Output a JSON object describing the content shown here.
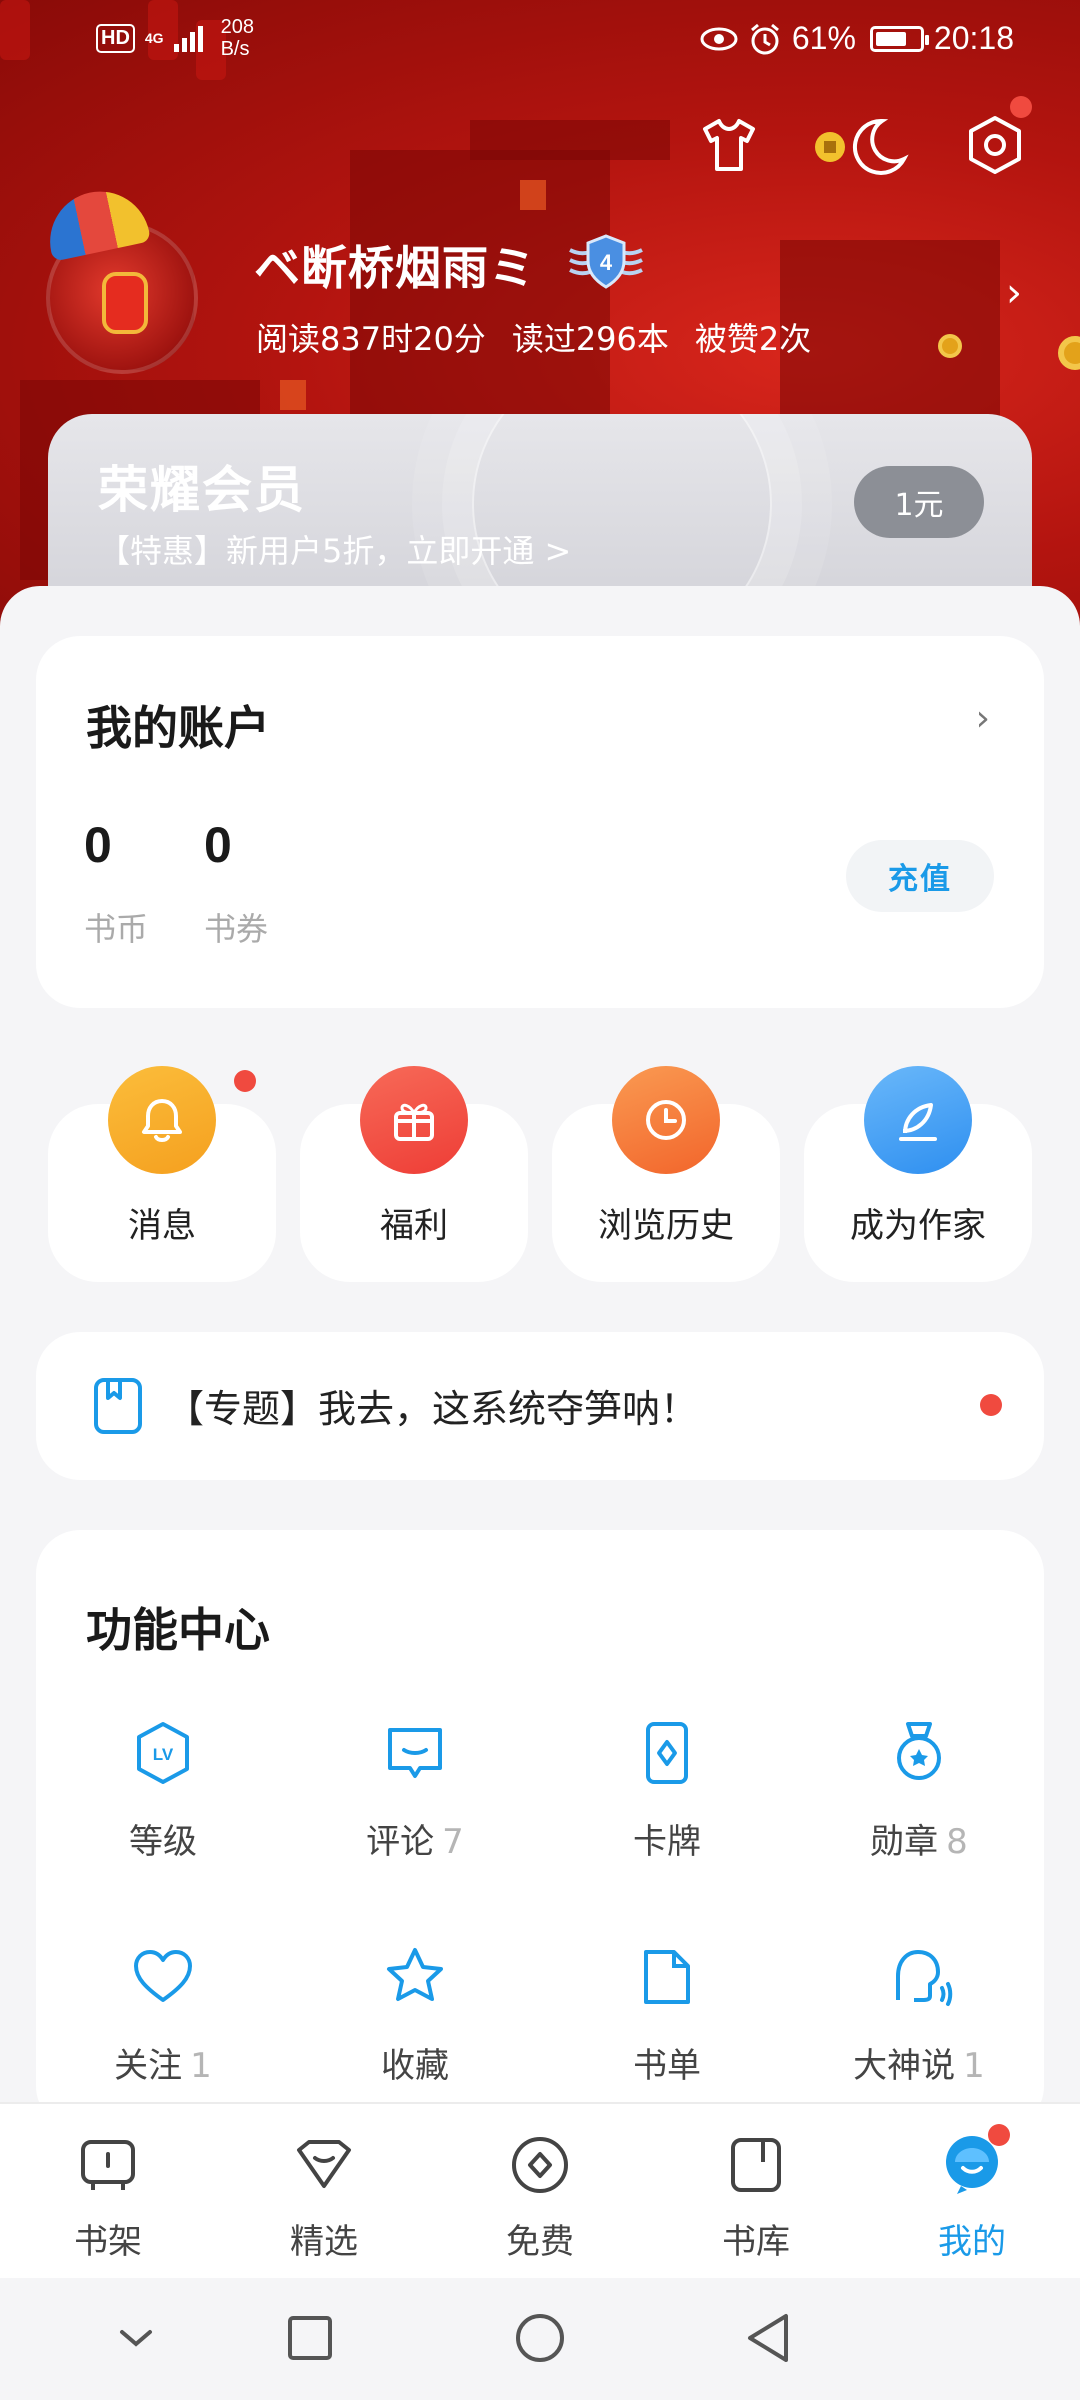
{
  "status_bar": {
    "network_badge": "HD",
    "signal_type": "4G",
    "speed": "208\nB/s",
    "battery": "61%",
    "time": "20:18"
  },
  "profile": {
    "username": "ベ断桥烟雨ミ",
    "level_badge": "4",
    "reading_time": "阅读837时20分",
    "books_read": "读过296本",
    "likes": "被赞2次"
  },
  "vip": {
    "title": "荣耀会员",
    "subtitle": "【特惠】新用户5折，立即开通 >",
    "button": "1元"
  },
  "account": {
    "title": "我的账户",
    "coins_value": "0",
    "coins_label": "书币",
    "vouchers_value": "0",
    "vouchers_label": "书券",
    "recharge": "充值"
  },
  "quick_actions": [
    {
      "label": "消息",
      "icon": "bell-icon",
      "color": "#f7a623"
    },
    {
      "label": "福利",
      "icon": "gift-icon",
      "color": "#f25545"
    },
    {
      "label": "浏览历史",
      "icon": "clock-icon",
      "color": "#f57b3c"
    },
    {
      "label": "成为作家",
      "icon": "quill-icon",
      "color": "#3d9df0"
    }
  ],
  "topic": {
    "text": "【专题】我去，这系统夺笋呐！"
  },
  "functions": {
    "title": "功能中心",
    "items": [
      {
        "label": "等级",
        "count": "",
        "icon": "level-icon"
      },
      {
        "label": "评论",
        "count": "7",
        "icon": "comment-icon"
      },
      {
        "label": "卡牌",
        "count": "",
        "icon": "card-icon"
      },
      {
        "label": "勋章",
        "count": "8",
        "icon": "medal-icon"
      },
      {
        "label": "关注",
        "count": "1",
        "icon": "heart-icon"
      },
      {
        "label": "收藏",
        "count": "",
        "icon": "star-icon"
      },
      {
        "label": "书单",
        "count": "",
        "icon": "booklist-icon"
      },
      {
        "label": "大神说",
        "count": "1",
        "icon": "speaker-icon"
      }
    ]
  },
  "bottom_nav": [
    {
      "label": "书架",
      "icon": "bookshelf-icon"
    },
    {
      "label": "精选",
      "icon": "featured-icon"
    },
    {
      "label": "免费",
      "icon": "free-icon"
    },
    {
      "label": "书库",
      "icon": "library-icon"
    },
    {
      "label": "我的",
      "icon": "profile-icon",
      "active": true
    }
  ],
  "colors": {
    "accent": "#1a9ae8",
    "notification_dot": "#f04a3f",
    "header_red": "#c0170f"
  }
}
